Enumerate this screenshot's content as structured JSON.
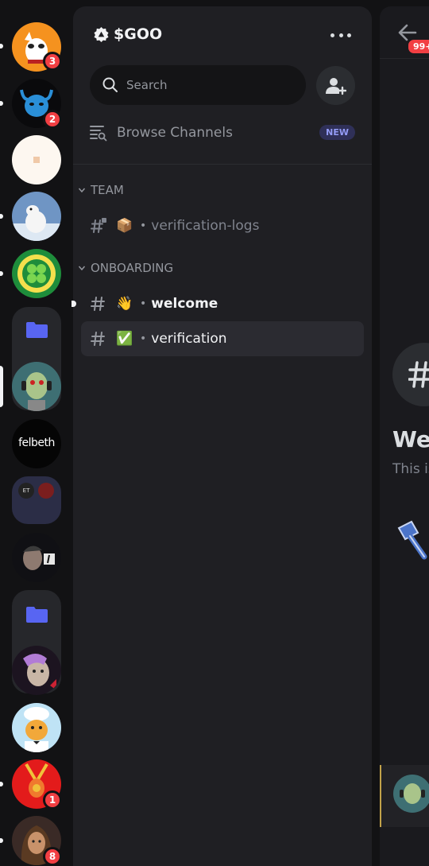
{
  "server_rail": {
    "servers": [
      {
        "name": "dog-avatar",
        "badge": "3"
      },
      {
        "name": "blue-ox-avatar",
        "badge": "2"
      },
      {
        "name": "plain-square-avatar",
        "badge": null
      },
      {
        "name": "snow-dog-avatar",
        "badge": null
      },
      {
        "name": "clover-chip-avatar",
        "badge": null
      },
      {
        "name": "folder-1",
        "badge": null
      },
      {
        "name": "zombie-headphones-avatar",
        "badge": null
      },
      {
        "name": "felbeth-avatar",
        "label": "felbeth",
        "badge": null
      },
      {
        "name": "group-folder-avatar",
        "label": "ET",
        "badge": null
      },
      {
        "name": "man-portrait-avatar",
        "badge": null
      },
      {
        "name": "folder-2",
        "badge": null
      },
      {
        "name": "goblin-avatar",
        "badge": null
      },
      {
        "name": "chef-avatar",
        "badge": null
      },
      {
        "name": "red-chain-avatar",
        "badge": "1"
      },
      {
        "name": "woman-portrait-avatar",
        "badge": "8"
      }
    ]
  },
  "panel": {
    "server_name": "$GOO",
    "search": {
      "placeholder": "Search"
    },
    "browse_channels": {
      "label": "Browse Channels",
      "badge": "NEW"
    },
    "categories": [
      {
        "name": "TEAM",
        "channels": [
          {
            "emoji": "📦",
            "name": "verification-logs",
            "state": "muted",
            "locked": true
          }
        ]
      },
      {
        "name": "ONBOARDING",
        "channels": [
          {
            "emoji": "👋",
            "name": "welcome",
            "state": "unread"
          },
          {
            "emoji": "✅",
            "name": "verification",
            "state": "active"
          }
        ]
      }
    ],
    "bullet": "•"
  },
  "chat": {
    "back_badge": "99+",
    "welcome_title": "Wel",
    "welcome_sub": "This is"
  },
  "colors": {
    "background": "#121214",
    "panel": "#1f1f23",
    "badge_red": "#f23f43",
    "new_badge_text": "#949cf7",
    "folder_blue": "#5865f2"
  }
}
